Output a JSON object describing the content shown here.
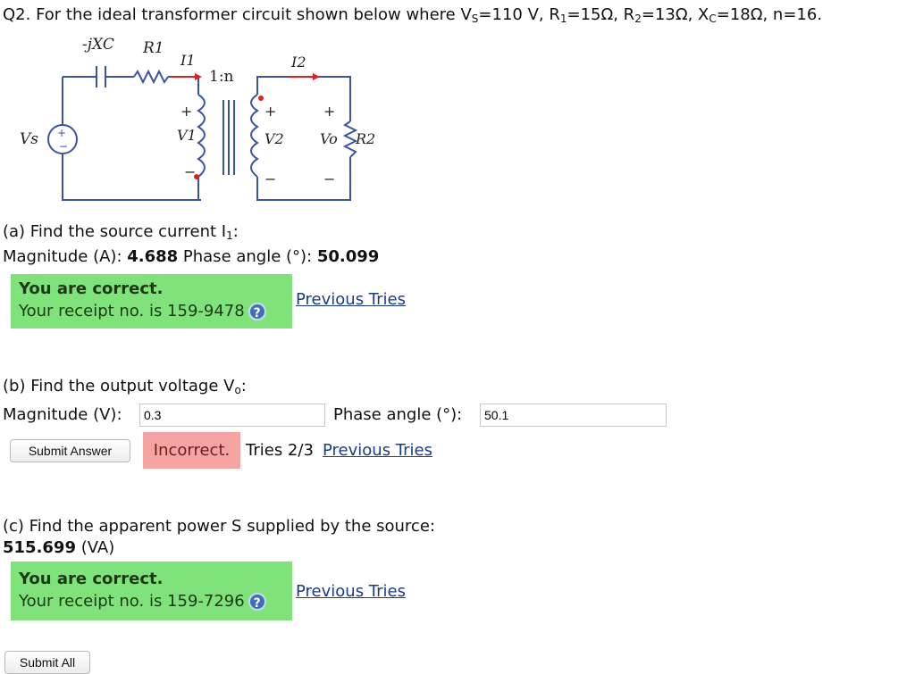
{
  "question": {
    "prefix": "Q2. For the ideal transformer circuit shown below where V",
    "vs_sub": "S",
    "vs_val": "=110 V, R",
    "r1_sub": "1",
    "r1_val": "=15Ω, R",
    "r2_sub": "2",
    "r2_val": "=13Ω, X",
    "xc_sub": "C",
    "xc_val": "=18Ω, n=16."
  },
  "circuit": {
    "xc_label": "-jXC",
    "r1_label": "R1",
    "i1_label": "I1",
    "ratio_label": "1:n",
    "i2_label": "I2",
    "vs_label": "Vs",
    "v1_label": "V1",
    "v2_label": "V2",
    "vo_label": "Vo",
    "r2_label": "R2"
  },
  "part_a": {
    "prompt": "(a) Find the source current I",
    "prompt_sub": "1",
    "prompt_end": ":",
    "mag_label": "Magnitude (A): ",
    "mag_value": "4.688",
    "phase_label": " Phase angle (°): ",
    "phase_value": "50.099",
    "correct": "You are correct.",
    "receipt": "Your receipt no. is 159-9478",
    "help_symbol": "?",
    "prev_tries": "Previous Tries"
  },
  "part_b": {
    "prompt": "(b) Find the output voltage V",
    "prompt_sub": "o",
    "prompt_end": ":",
    "mag_label": "Magnitude (V):",
    "mag_input": "0.3",
    "phase_label": "Phase angle (°):",
    "phase_input": "50.1",
    "submit": "Submit Answer",
    "status": "Incorrect.",
    "tries": "Tries 2/3",
    "prev_tries": "Previous Tries"
  },
  "part_c": {
    "prompt": "(c) Find the apparent power S supplied by the source:",
    "value": "515.699",
    "unit": " (VA)",
    "correct": "You are correct.",
    "receipt": "Your receipt no. is 159-7296",
    "help_symbol": "?",
    "prev_tries": "Previous Tries"
  },
  "footer": {
    "submit_all": "Submit All"
  },
  "colors": {
    "correct_bg": "#7fe27b",
    "incorrect_bg": "#f5a3a3",
    "link": "#1a3a8a",
    "arrow": "#e02020"
  }
}
